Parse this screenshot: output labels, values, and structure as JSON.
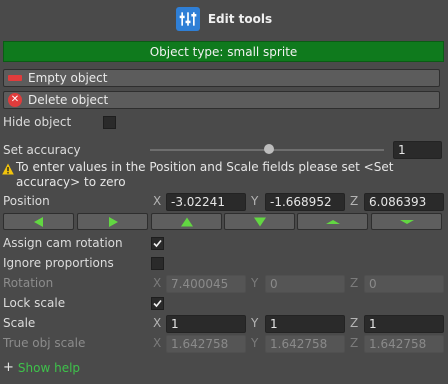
{
  "window": {
    "title": "Edit tools",
    "title_icon": "sliders-icon"
  },
  "banner": {
    "text": "Object type: small sprite",
    "color": "#0f7a1d"
  },
  "buttons": {
    "empty_object": "Empty object",
    "delete_object": "Delete object"
  },
  "hide_object": {
    "label": "Hide object",
    "checked": false
  },
  "accuracy": {
    "label": "Set accuracy",
    "slider_fraction": 0.5,
    "value": "1"
  },
  "warning": {
    "icon": "warning-icon",
    "text": "To enter values in the Position and Scale fields please set <Set accuracy> to zero"
  },
  "position": {
    "label": "Position",
    "x_axis": "X",
    "y_axis": "Y",
    "z_axis": "Z",
    "x": "-3.02241",
    "y": "-1.668952",
    "z": "6.086393"
  },
  "arrow_buttons": [
    {
      "name": "move-left",
      "icon": "arrow-left-icon"
    },
    {
      "name": "move-right",
      "icon": "arrow-right-icon"
    },
    {
      "name": "move-up",
      "icon": "arrow-up-icon"
    },
    {
      "name": "move-down",
      "icon": "arrow-down-icon"
    },
    {
      "name": "move-forward",
      "icon": "chevron-up-icon"
    },
    {
      "name": "move-back",
      "icon": "chevron-down-icon"
    }
  ],
  "assign_cam_rotation": {
    "label": "Assign cam rotation",
    "checked": true
  },
  "ignore_proportions": {
    "label": "Ignore proportions",
    "checked": false
  },
  "rotation": {
    "label": "Rotation",
    "x_axis": "X",
    "y_axis": "Y",
    "z_axis": "Z",
    "x": "7.400045",
    "y": "0",
    "z": "0",
    "disabled": true
  },
  "lock_scale": {
    "label": "Lock scale",
    "checked": true
  },
  "scale": {
    "label": "Scale",
    "x_axis": "X",
    "y_axis": "Y",
    "z_axis": "Z",
    "x": "1",
    "y": "1",
    "z": "1"
  },
  "true_obj_scale": {
    "label": "True obj scale",
    "x_axis": "X",
    "y_axis": "Y",
    "z_axis": "Z",
    "x": "1.642758",
    "y": "1.642758",
    "z": "1.642758",
    "disabled": true
  },
  "help": {
    "plus": "+",
    "label": "Show help",
    "color": "#3ec24a"
  },
  "colors": {
    "arrow_green": "#62d742",
    "panel_bg": "#4a4a4a",
    "field_bg": "#2a2a2a"
  }
}
